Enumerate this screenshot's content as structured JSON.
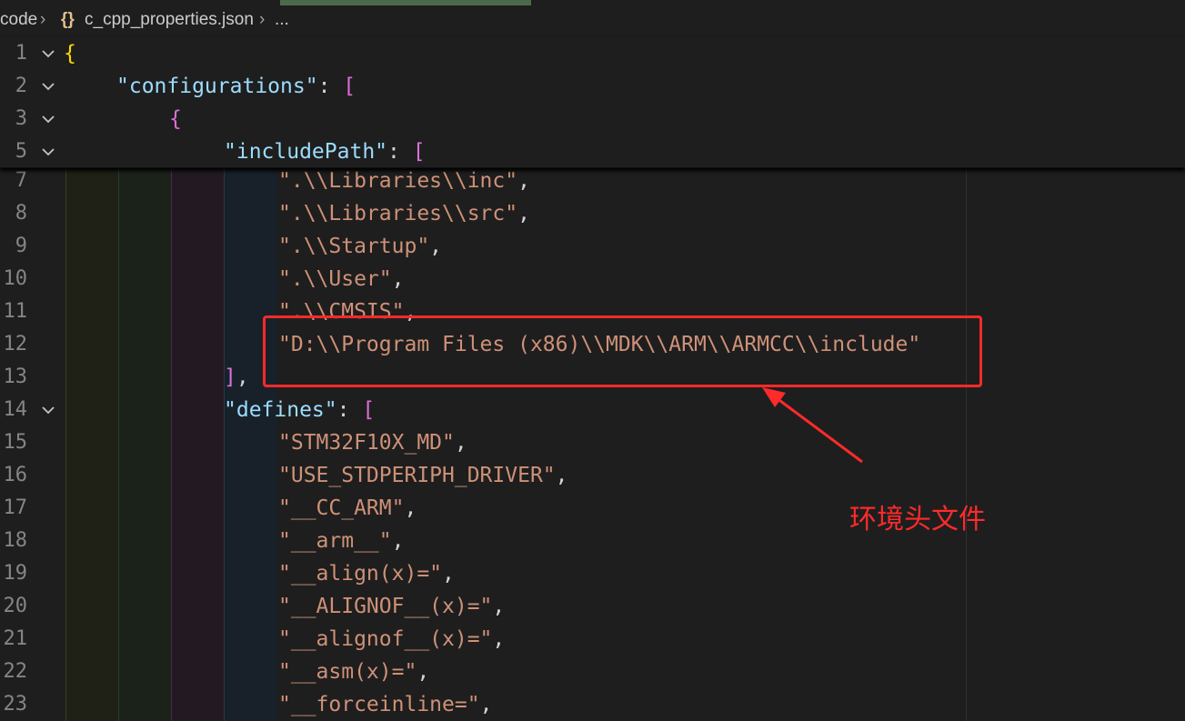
{
  "breadcrumb": {
    "folder": "code",
    "file_icon": "{}",
    "file": "c_cpp_properties.json",
    "more": "..."
  },
  "icons": {
    "chevron": "chevron-right-icon",
    "fold": "chevron-down-icon",
    "arrow": "arrow-icon"
  },
  "colors": {
    "highlight": "#ff2a2a",
    "key": "#9cdcfe",
    "string": "#ce9178",
    "bracket1": "#ffd700",
    "bracket2": "#da70d6"
  },
  "sticky_lines": [
    {
      "num": "1",
      "foldable": true
    },
    {
      "num": "2",
      "foldable": true
    },
    {
      "num": "3",
      "foldable": true
    },
    {
      "num": "5",
      "foldable": true
    }
  ],
  "lines": [
    {
      "num": "7",
      "text": "\".\\\\Libraries\\\\inc\","
    },
    {
      "num": "8",
      "text": "\".\\\\Libraries\\\\src\","
    },
    {
      "num": "9",
      "text": "\".\\\\Startup\","
    },
    {
      "num": "10",
      "text": "\".\\\\User\","
    },
    {
      "num": "11",
      "text": "\".\\\\CMSIS\","
    },
    {
      "num": "12",
      "text": "\"D:\\\\Program Files (x86)\\\\MDK\\\\ARM\\\\ARMCC\\\\include\""
    },
    {
      "num": "13",
      "text": "],"
    },
    {
      "num": "14",
      "text": "\"defines\": [",
      "foldable": true
    },
    {
      "num": "15",
      "text": "\"STM32F10X_MD\","
    },
    {
      "num": "16",
      "text": "\"USE_STDPERIPH_DRIVER\","
    },
    {
      "num": "17",
      "text": "\"__CC_ARM\","
    },
    {
      "num": "18",
      "text": "\"__arm__\","
    },
    {
      "num": "19",
      "text": "\"__align(x)=\","
    },
    {
      "num": "20",
      "text": "\"__ALIGNOF__(x)=\","
    },
    {
      "num": "21",
      "text": "\"__alignof__(x)=\","
    },
    {
      "num": "22",
      "text": "\"__asm(x)=\","
    },
    {
      "num": "23",
      "text": "\"__forceinline=\","
    }
  ],
  "code": {
    "l1_brace": "{",
    "l2_key": "\"configurations\"",
    "l2_colon": ": ",
    "l2_bracket": "[",
    "l3_brace": "{",
    "l5_key": "\"includePath\"",
    "l5_colon": ": ",
    "l5_bracket": "[",
    "l13_bracket": "]",
    "l13_comma": ",",
    "l14_key": "\"defines\"",
    "l14_colon": ": ",
    "l14_bracket": "["
  },
  "annotation": {
    "label": "环境头文件"
  }
}
